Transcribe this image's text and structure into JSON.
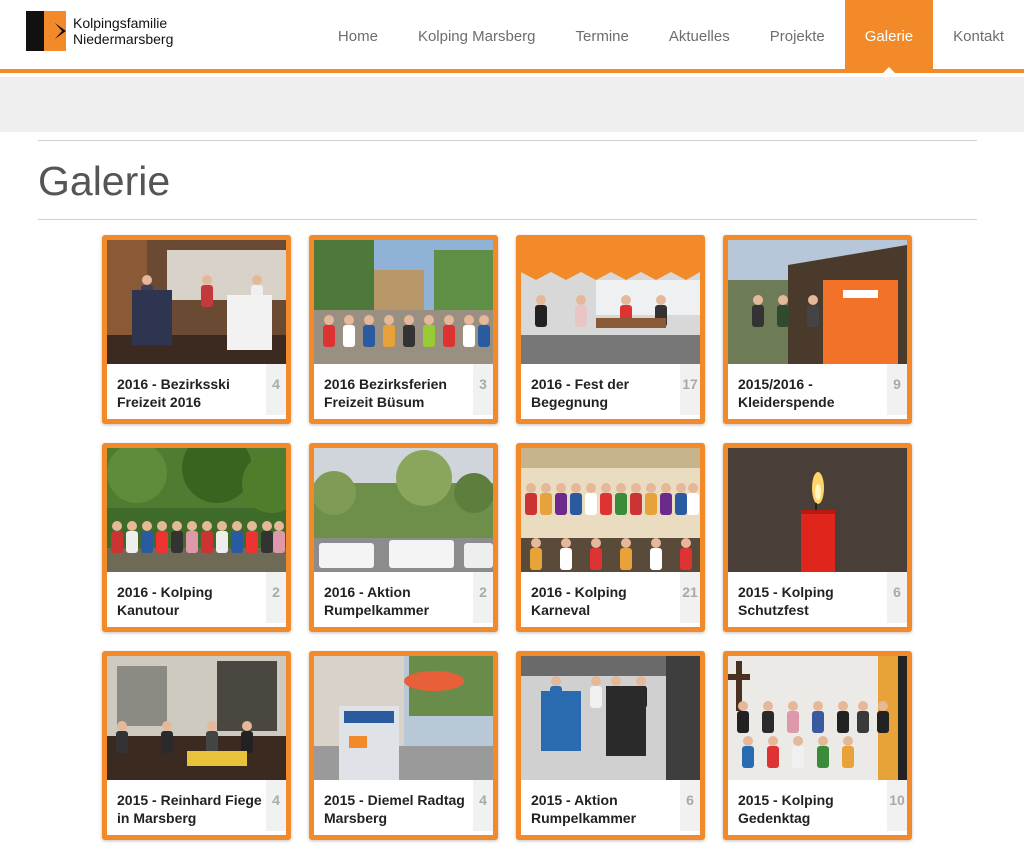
{
  "brand": {
    "line1": "Kolpingsfamilie",
    "line2": "Niedermarsberg",
    "accent": "#f28a2a"
  },
  "nav": [
    {
      "label": "Home",
      "active": false
    },
    {
      "label": "Kolping Marsberg",
      "active": false
    },
    {
      "label": "Termine",
      "active": false
    },
    {
      "label": "Aktuelles",
      "active": false
    },
    {
      "label": "Projekte",
      "active": false
    },
    {
      "label": "Galerie",
      "active": true
    },
    {
      "label": "Kontakt",
      "active": false
    }
  ],
  "page": {
    "title": "Galerie"
  },
  "gallery": [
    {
      "title": "2016 - Bezirksski Freizeit 2016",
      "count": "4",
      "scene": "indoor-party"
    },
    {
      "title": "2016 Bezirksferien Freizeit Büsum",
      "count": "3",
      "scene": "playground-group"
    },
    {
      "title": "2016 - Fest der Begegnung",
      "count": "17",
      "scene": "tent-festival"
    },
    {
      "title": "2015/2016 - Kleiderspende",
      "count": "9",
      "scene": "barn-container"
    },
    {
      "title": "2016 - Kolping Kanutour",
      "count": "2",
      "scene": "forest-group"
    },
    {
      "title": "2016 - Aktion Rumpelkammer",
      "count": "2",
      "scene": "vans-landscape"
    },
    {
      "title": "2016 - Kolping Karneval",
      "count": "21",
      "scene": "stage-costumes"
    },
    {
      "title": "2015 - Kolping Schutzfest",
      "count": "6",
      "scene": "red-candle"
    },
    {
      "title": "2015 - Reinhard Fiege in Marsberg",
      "count": "4",
      "scene": "restaurant"
    },
    {
      "title": "2015 - Diemel Radtag Marsberg",
      "count": "4",
      "scene": "street-stand"
    },
    {
      "title": "2015 - Aktion Rumpelkammer",
      "count": "6",
      "scene": "truck-group"
    },
    {
      "title": "2015 - Kolping Gedenktag",
      "count": "10",
      "scene": "church-group"
    }
  ]
}
